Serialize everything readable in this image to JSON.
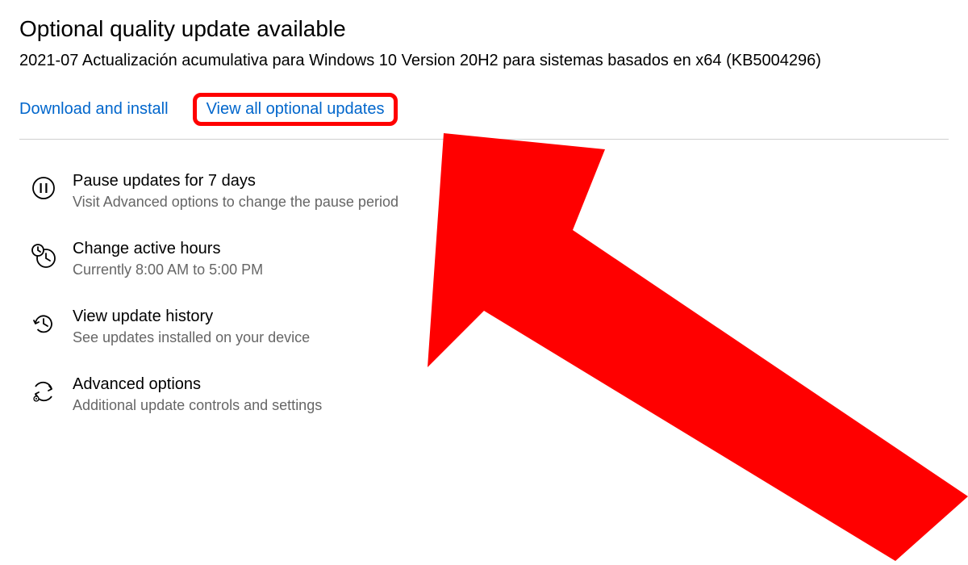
{
  "heading": "Optional quality update available",
  "updateName": "2021-07 Actualización acumulativa para Windows 10 Version 20H2 para sistemas basados en x64 (KB5004296)",
  "links": {
    "download": "Download and install",
    "viewAll": "View all optional updates"
  },
  "options": [
    {
      "title": "Pause updates for 7 days",
      "subtitle": "Visit Advanced options to change the pause period"
    },
    {
      "title": "Change active hours",
      "subtitle": "Currently 8:00 AM to 5:00 PM"
    },
    {
      "title": "View update history",
      "subtitle": "See updates installed on your device"
    },
    {
      "title": "Advanced options",
      "subtitle": "Additional update controls and settings"
    }
  ]
}
